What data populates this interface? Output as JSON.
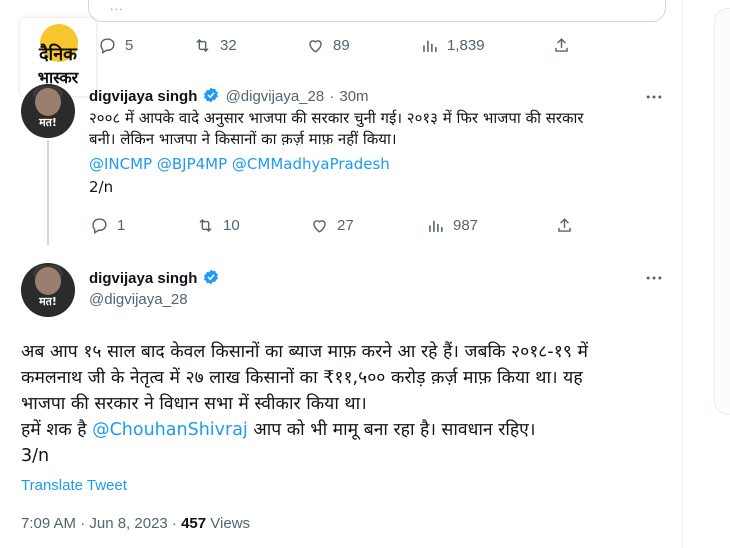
{
  "top_tweet": {
    "quote_faded_text": "...",
    "actions": {
      "replies": "5",
      "retweets": "32",
      "likes": "89",
      "views": "1,839"
    }
  },
  "logo": {
    "line1": "दैनिक",
    "line2": "भास्कर"
  },
  "tweet2": {
    "name": "digvijaya singh",
    "handle": "@digvijaya_28",
    "separator": "·",
    "time": "30m",
    "avatar_caption": "मत!",
    "line1": "२००८ में आपके वादे अनुसार भाजपा की सरकार चुनी गई। २०१३ में फिर भाजपा की सरकार",
    "line2": "बनी। लेकिन भाजपा ने किसानों का क़र्ज़ माफ़ नहीं किया।",
    "mentions": "@INCMP @BJP4MP @CMMadhyaPradesh",
    "count": "2/n",
    "actions": {
      "replies": "1",
      "retweets": "10",
      "likes": "27",
      "views": "987"
    }
  },
  "tweet3": {
    "name": "digvijaya singh",
    "handle": "@digvijaya_28",
    "avatar_caption": "मत!",
    "line1": "अब आप १५ साल बाद केवल किसानों का ब्याज माफ़ करने आ रहे हैं। जबकि २०१८-१९ में",
    "line2": "कमलनाथ जी के नेतृत्व में २७ लाख किसानों का ₹११,५०० करोड़ क़र्ज़ माफ़ किया था। यह",
    "line3": "भाजपा की सरकार ने विधान सभा में स्वीकार किया था।",
    "line4_pre": "हमें शक है ",
    "line4_mention": "@ChouhanShivraj",
    "line4_post": " आप को भी मामू बना रहा है। सावधान रहिए।",
    "count": "3/n",
    "translate": "Translate Tweet",
    "timestamp": "7:09 AM · Jun 8, 2023 · ",
    "views_count": "457",
    "views_label": " Views"
  },
  "colors": {
    "link": "#1d9bf0",
    "verified": "#1d9bf0",
    "muted": "#536471"
  }
}
